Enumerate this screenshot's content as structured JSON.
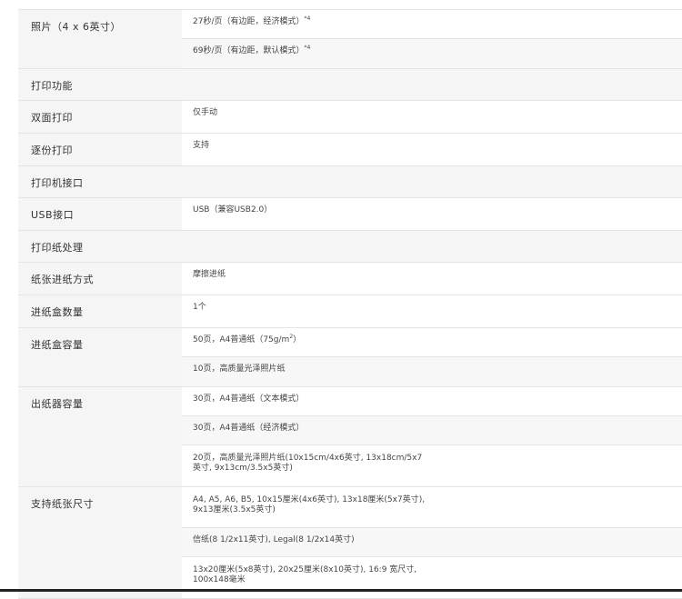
{
  "rows": [
    {
      "label": "照片（4 x 6英寸）",
      "values": [
        {
          "text": "27秒/页（有边距，经济模式）",
          "sup": "*4"
        },
        {
          "text": "69秒/页（有边距，默认模式）",
          "sup": "*4"
        }
      ]
    },
    {
      "label": "打印功能"
    },
    {
      "label": "双面打印",
      "values": [
        {
          "text": "仅手动"
        }
      ]
    },
    {
      "label": "逐份打印",
      "values": [
        {
          "text": "支持"
        }
      ]
    },
    {
      "label": "打印机接口"
    },
    {
      "label": "USB接口",
      "values": [
        {
          "text": "USB（兼容USB2.0）"
        }
      ]
    },
    {
      "label": "打印纸处理"
    },
    {
      "label": "纸张进纸方式",
      "values": [
        {
          "text": "摩擦进纸"
        }
      ]
    },
    {
      "label": "进纸盒数量",
      "values": [
        {
          "text": "1个"
        }
      ]
    },
    {
      "label": "进纸盒容量",
      "values": [
        {
          "text": "50页，A4普通纸（75g/m",
          "sup": "2",
          "after": "）"
        },
        {
          "text": "10页，高质量光泽照片纸"
        }
      ]
    },
    {
      "label": "出纸器容量",
      "values": [
        {
          "text": "30页，A4普通纸（文本模式）"
        },
        {
          "text": "30页，A4普通纸（经济模式）"
        },
        {
          "text": "20页，高质量光泽照片纸(10x15cm/4x6英寸, 13x18cm/5x7",
          "line2": "英寸, 9x13cm/3.5x5英寸)"
        }
      ]
    },
    {
      "label": "支持纸张尺寸",
      "values": [
        {
          "text": "A4, A5, A6, B5, 10x15厘米(4x6英寸), 13x18厘米(5x7英寸),",
          "line2": "9x13厘米(3.5x5英寸)"
        },
        {
          "text": "信纸(8 1/2x11英寸), Legal(8 1/2x14英寸)"
        },
        {
          "text": "13x20厘米(5x8英寸), 20x25厘米(8x10英寸), 16:9 宽尺寸,",
          "line2": "100x148毫米"
        }
      ]
    }
  ]
}
